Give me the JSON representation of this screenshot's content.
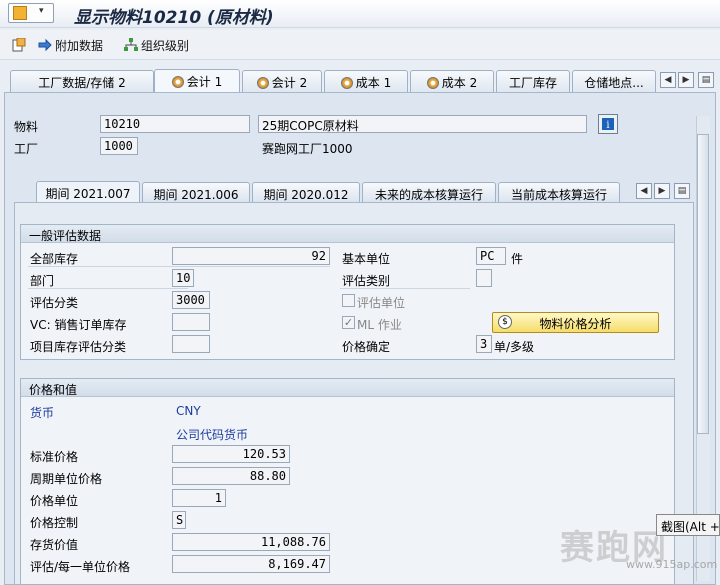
{
  "window": {
    "title": "显示物料10210 (原材料)"
  },
  "toolbar": {
    "additional_data": "附加数据",
    "org_levels": "组织级别"
  },
  "tabs": [
    {
      "label": "工厂数据/存储 2",
      "selected": false,
      "icon": ""
    },
    {
      "label": "会计 1",
      "selected": true,
      "icon": "status-ok-icon"
    },
    {
      "label": "会计 2",
      "selected": false,
      "icon": "status-ok-icon"
    },
    {
      "label": "成本 1",
      "selected": false,
      "icon": "status-ok-icon"
    },
    {
      "label": "成本 2",
      "selected": false,
      "icon": "status-ok-icon"
    },
    {
      "label": "工厂库存",
      "selected": false,
      "icon": ""
    },
    {
      "label": "仓储地点...",
      "selected": false,
      "icon": ""
    }
  ],
  "header": {
    "material_label": "物料",
    "material_value": "10210",
    "material_desc": "25期COPC原材料",
    "plant_label": "工厂",
    "plant_value": "1000",
    "plant_desc": "赛跑网工厂1000"
  },
  "period_tabs": [
    {
      "label": "期间 2021.007",
      "selected": true
    },
    {
      "label": "期间 2021.006",
      "selected": false
    },
    {
      "label": "期间 2020.012",
      "selected": false
    },
    {
      "label": "未来的成本核算运行",
      "selected": false
    },
    {
      "label": "当前成本核算运行",
      "selected": false
    }
  ],
  "general": {
    "title": "一般评估数据",
    "total_stock_label": "全部库存",
    "total_stock_value": "92",
    "base_unit_label": "基本单位",
    "base_unit_value": "PC",
    "base_unit_text": "件",
    "division_label": "部门",
    "division_value": "10",
    "valuation_category_label": "评估类别",
    "valuation_class_label": "评估分类",
    "valuation_class_value": "3000",
    "valuated_unit_label": "评估单位",
    "vc_label": "VC: 销售订单库存",
    "ml_label": "ML 作业",
    "analysis_button": "物料价格分析",
    "project_stock_label": "项目库存评估分类",
    "price_determination_label": "价格确定",
    "price_determination_value": "3",
    "price_determination_text": "单/多级"
  },
  "prices": {
    "title": "价格和值",
    "currency_label": "货币",
    "currency_value": "CNY",
    "currency_desc": "公司代码货币",
    "standard_price_label": "标准价格",
    "standard_price_value": "120.53",
    "periodic_price_label": "周期单位价格",
    "periodic_price_value": "88.80",
    "price_unit_label": "价格单位",
    "price_unit_value": "1",
    "price_control_label": "价格控制",
    "price_control_value": "S",
    "stock_value_label": "存货价值",
    "stock_value_value": "11,088.76",
    "valuated_per_unit_label": "评估/每一单位价格",
    "valuated_per_unit_value": "8,169.47"
  },
  "tooltip": "截图(Alt +",
  "watermark": "赛跑网",
  "watermark_url": "www.915ap.com",
  "colors": {
    "accent": "#f5dd6a",
    "panel": "#dde6f0",
    "link": "#1d3c9e"
  }
}
